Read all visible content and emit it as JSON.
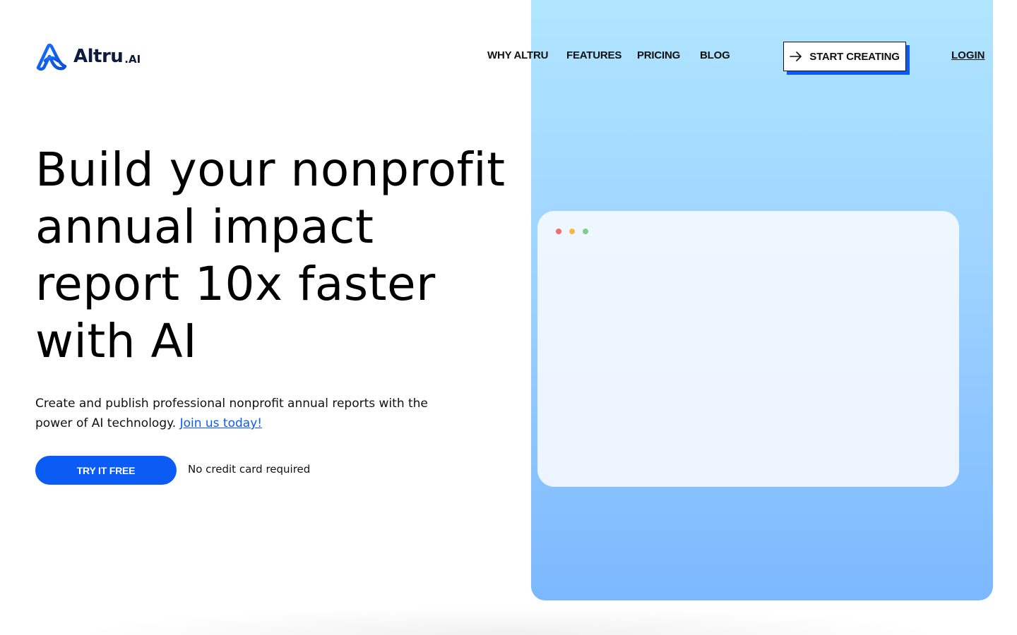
{
  "brand": {
    "name": "Altru",
    "suffix": ".AI",
    "logo_icon": "altru-logo-icon",
    "colors": {
      "brand_blue": "#0a5cf5",
      "navy": "#0d1b3e"
    }
  },
  "nav": {
    "links": [
      "WHY ALTRU",
      "FEATURES",
      "PRICING",
      "BLOG"
    ],
    "cta_label": "START CREATING",
    "cta_icon": "arrow-right-icon",
    "login_label": "LOGIN"
  },
  "hero": {
    "headline_lines": [
      "Build your nonprofit",
      "annual impact",
      "report 10x faster",
      "with AI"
    ],
    "subtext": "Create and publish professional nonprofit annual reports with the power of AI technology.",
    "join_link": "Join us today!",
    "primary_button": "TRY IT FREE",
    "note": "No credit card required"
  }
}
